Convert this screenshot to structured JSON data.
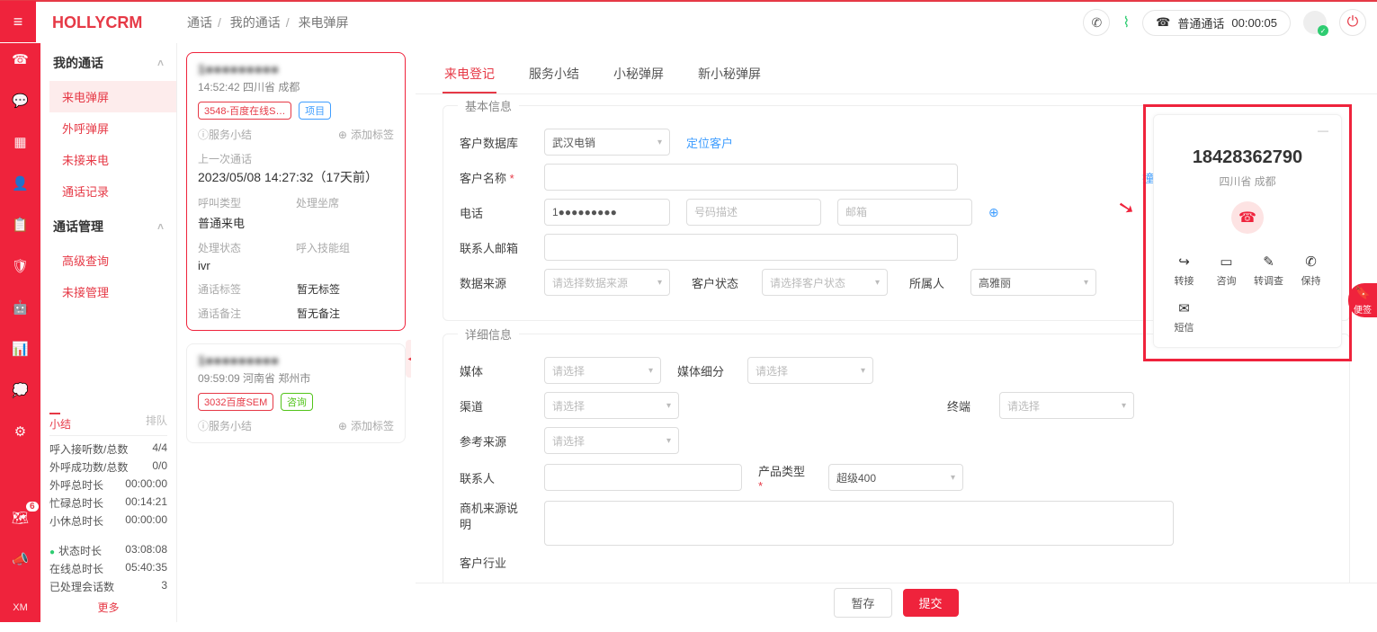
{
  "brand": "HOLLYCRM",
  "breadcrumb": [
    "通话",
    "我的通话",
    "来电弹屏"
  ],
  "header": {
    "call_type_label": "普通通话",
    "call_timer": "00:00:05"
  },
  "sidenav": {
    "group1_title": "我的通话",
    "group1_items": [
      "来电弹屏",
      "外呼弹屏",
      "未接来电",
      "通话记录"
    ],
    "group2_title": "通话管理",
    "group2_items": [
      "高级查询",
      "未接管理"
    ],
    "stats_head_left": "小结",
    "stats_head_right": "排队",
    "rows": [
      {
        "k": "呼入接听数/总数",
        "v": "4/4"
      },
      {
        "k": "外呼成功数/总数",
        "v": "0/0"
      },
      {
        "k": "外呼总时长",
        "v": "00:00:00"
      },
      {
        "k": "忙碌总时长",
        "v": "00:14:21"
      },
      {
        "k": "小休总时长",
        "v": "00:00:00"
      }
    ],
    "rows2": [
      {
        "k": "状态时长",
        "v": "03:08:08",
        "green": true
      },
      {
        "k": "在线总时长",
        "v": "05:40:35"
      },
      {
        "k": "已处理会话数",
        "v": "3"
      }
    ],
    "rail_badge": "6",
    "rail_xm": "XM",
    "more": "更多"
  },
  "cards": [
    {
      "time_loc": "14:52:42 四川省 成都",
      "tag1": "3548-百度在线S…",
      "tag2": "项目",
      "svc": "服务小结",
      "addtag": "添加标签",
      "last_label": "上一次通话",
      "last_val": "2023/05/08 14:27:32（17天前）",
      "k1": "呼叫类型",
      "k2": "处理坐席",
      "v1": "普通来电",
      "v2": "",
      "k3": "处理状态",
      "k4": "呼入技能组",
      "v3": "ivr",
      "v4": "",
      "k5": "通话标签",
      "v5": "暂无标签",
      "k6": "通话备注",
      "v6": "暂无备注"
    },
    {
      "time_loc": "09:59:09 河南省 郑州市",
      "tag1": "3032百度SEM",
      "tag2": "咨询",
      "svc": "服务小结",
      "addtag": "添加标签"
    }
  ],
  "tabs": [
    "来电登记",
    "服务小结",
    "小秘弹屏",
    "新小秘弹屏"
  ],
  "form": {
    "section1": "基本信息",
    "section2": "详细信息",
    "f_db": "客户数据库",
    "f_db_val": "武汉电销",
    "f_db_link": "定位客户",
    "f_name": "客户名称",
    "f_name_link": "撞单查询",
    "f_phone": "电话",
    "f_phone_desc_ph": "号码描述",
    "f_email_ph": "邮箱",
    "f_contact_email": "联系人邮箱",
    "f_source": "数据来源",
    "f_source_ph": "请选择数据来源",
    "f_status": "客户状态",
    "f_status_ph": "请选择客户状态",
    "f_owner": "所属人",
    "f_owner_val": "高雅丽",
    "f_media": "媒体",
    "f_media_ph": "请选择",
    "f_media_sub": "媒体细分",
    "f_media_sub_ph": "请选择",
    "f_channel": "渠道",
    "f_channel_ph": "请选择",
    "f_terminal": "终端",
    "f_terminal_ph": "请选择",
    "f_ref": "参考来源",
    "f_ref_ph": "请选择",
    "f_contact": "联系人",
    "f_prod": "产品类型",
    "f_prod_val": "超级400",
    "f_biz_src": "商机来源说明",
    "f_industry": "客户行业"
  },
  "caller": {
    "number": "18428362790",
    "location": "四川省 成都",
    "actions": [
      "转接",
      "咨询",
      "转调查",
      "保持",
      "短信"
    ],
    "action_icons": [
      "↪",
      "▭",
      "✎",
      "✆",
      "✉"
    ]
  },
  "bookmark_label": "便签",
  "bottom": {
    "save": "暂存",
    "submit": "提交"
  }
}
